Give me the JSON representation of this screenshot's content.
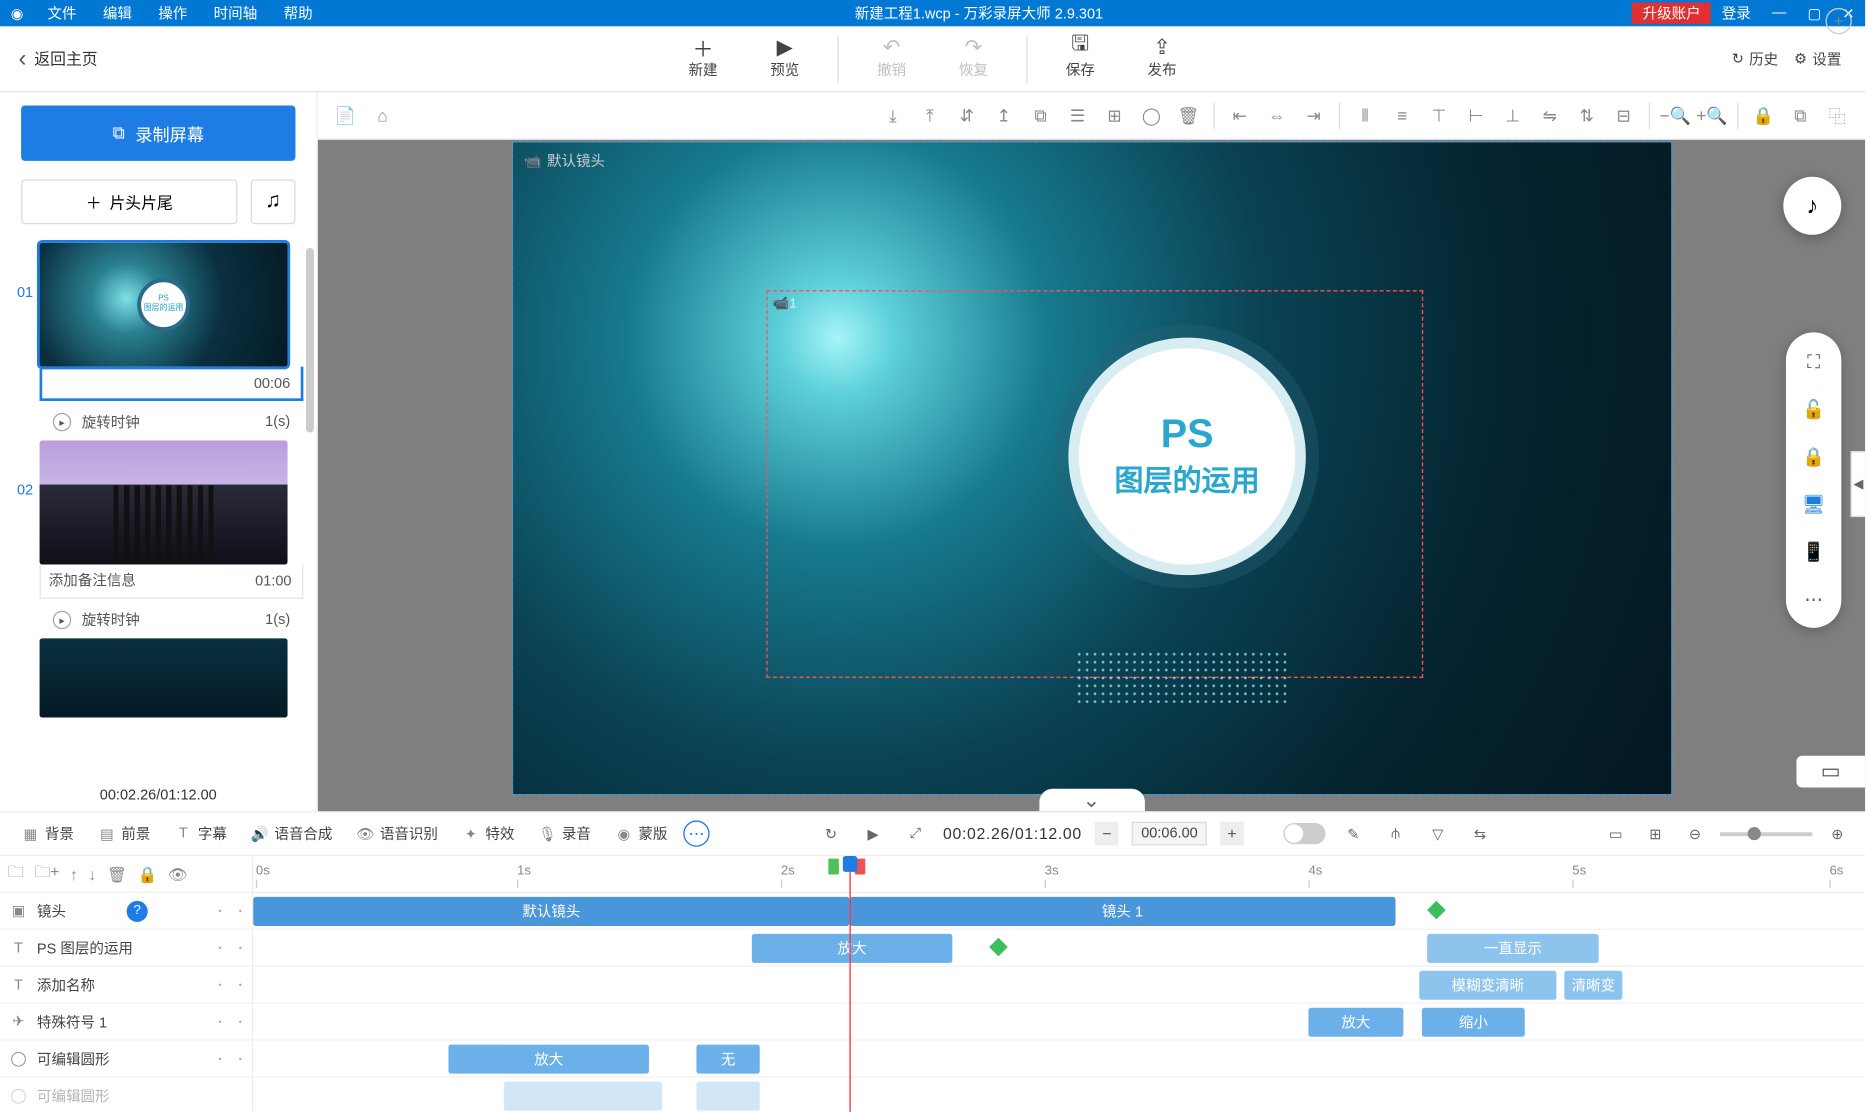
{
  "titlebar": {
    "menus": [
      "文件",
      "编辑",
      "操作",
      "时间轴",
      "帮助"
    ],
    "doc": "新建工程1.wcp",
    "app": "万彩录屏大师 2.9.301",
    "upgrade": "升级账户",
    "login": "登录"
  },
  "topbar": {
    "back": "返回主页",
    "tools": [
      {
        "id": "new",
        "label": "新建",
        "icon": "＋"
      },
      {
        "id": "preview",
        "label": "预览",
        "icon": "▶"
      },
      {
        "id": "undo",
        "label": "撤销",
        "icon": "↶",
        "disabled": true
      },
      {
        "id": "redo",
        "label": "恢复",
        "icon": "↷",
        "disabled": true
      },
      {
        "id": "save",
        "label": "保存",
        "icon": "🖫"
      },
      {
        "id": "publish",
        "label": "发布",
        "icon": "⇪"
      }
    ],
    "history": "历史",
    "settings": "设置"
  },
  "left": {
    "record": "录制屏幕",
    "intro": "片头片尾",
    "scenes": [
      {
        "num": "01",
        "time": "00:06",
        "transition": "旋转时钟",
        "tdur": "1(s)",
        "sel": true
      },
      {
        "num": "02",
        "note": "添加备注信息",
        "time": "01:00",
        "transition": "旋转时钟",
        "tdur": "1(s)"
      }
    ],
    "current": "00:02.26/01:12.00"
  },
  "canvas": {
    "default_cam": "默认镜头",
    "cam1": "1",
    "ps": "PS",
    "subtitle": "图层的运用"
  },
  "tabs": {
    "items": [
      {
        "icon": "▦",
        "label": "背景"
      },
      {
        "icon": "▤",
        "label": "前景"
      },
      {
        "icon": "T",
        "label": "字幕"
      },
      {
        "icon": "🔊",
        "label": "语音合成"
      },
      {
        "icon": "👁",
        "label": "语音识别"
      },
      {
        "icon": "✦",
        "label": "特效"
      },
      {
        "icon": "🎙",
        "label": "录音"
      },
      {
        "icon": "◉",
        "label": "蒙版"
      }
    ],
    "time": "00:02.26/01:12.00",
    "duration": "00:06.00"
  },
  "ruler": [
    "0s",
    "1s",
    "2s",
    "3s",
    "4s",
    "5s",
    "6s"
  ],
  "tracks": [
    {
      "icon": "▣",
      "label": "镜头",
      "q": true
    },
    {
      "icon": "T",
      "label": "PS 图层的运用"
    },
    {
      "icon": "T",
      "label": "添加名称"
    },
    {
      "icon": "✈",
      "label": "特殊符号 1"
    },
    {
      "icon": "◯",
      "label": "可编辑圆形"
    },
    {
      "icon": "◯",
      "label": "可编辑圆形"
    }
  ],
  "clips": {
    "cam_default": "默认镜头",
    "cam1": "镜头 1",
    "zoom_in": "放大",
    "always_show": "一直显示",
    "blur_clear": "模糊变清晰",
    "clear_change": "清晰变",
    "zoom_out": "缩小",
    "none": "无"
  }
}
